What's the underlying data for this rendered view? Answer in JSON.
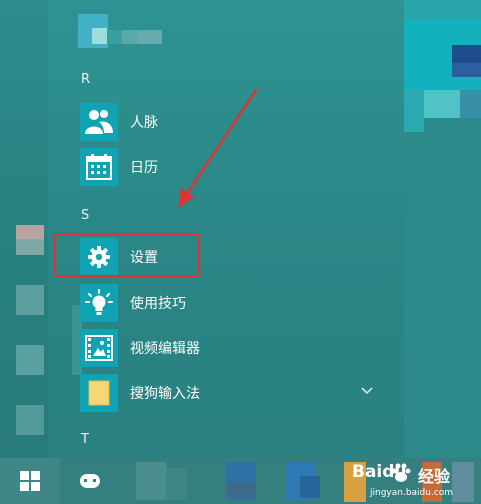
{
  "sections": [
    {
      "letter": "R"
    },
    {
      "letter": "S"
    },
    {
      "letter": "T"
    }
  ],
  "apps": [
    {
      "label": "人脉",
      "icon": "people-icon"
    },
    {
      "label": "日历",
      "icon": "calendar-icon"
    },
    {
      "label": "设置",
      "icon": "gear-icon"
    },
    {
      "label": "使用技巧",
      "icon": "lightbulb-icon"
    },
    {
      "label": "视频编辑器",
      "icon": "video-editor-icon"
    },
    {
      "label": "搜狗输入法",
      "icon": "folder-icon"
    }
  ],
  "colors": {
    "tile": "#0fa3b4",
    "highlight": "#e03232",
    "background": "#2c8b8b"
  },
  "watermark": {
    "brand": "Baidu",
    "brand_cn": "经验",
    "url": "jingyan.baidu.com"
  }
}
